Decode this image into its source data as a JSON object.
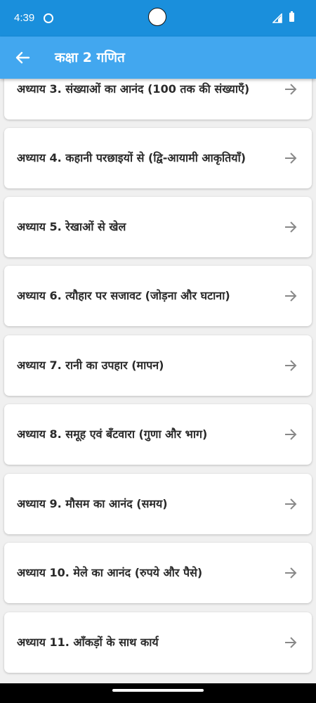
{
  "status_bar": {
    "time": "4:39"
  },
  "app_bar": {
    "title": "कक्षा 2 गणित"
  },
  "chapters": [
    {
      "label": "अध्याय 3. संख्याओं का आनंद (100 तक की संख्याएँ)"
    },
    {
      "label": "अध्याय 4. कहानी परछाइयों से (द्वि-आयामी आकृतियाँ)"
    },
    {
      "label": "अध्याय 5. रेखाओं से खेल"
    },
    {
      "label": "अध्याय 6. त्यौहार पर सजावट (जोड़ना और घटाना)"
    },
    {
      "label": "अध्याय 7. रानी का उपहार (मापन)"
    },
    {
      "label": "अध्याय 8. समूह एवं बँटवारा (गुणा और भाग)"
    },
    {
      "label": "अध्याय 9. मौसम का आनंद (समय)"
    },
    {
      "label": "अध्याय 10. मेले का आनंद (रुपये और पैसे)"
    },
    {
      "label": "अध्याय 11. आँकड़ों के साथ कार्य"
    }
  ],
  "icons": {
    "back": "arrow-left-icon",
    "item": "arrow-right-icon"
  },
  "colors": {
    "status_bar": "#1a8fdc",
    "app_bar": "#42a7ef",
    "card": "#ffffff",
    "background": "#f0f0f0"
  }
}
